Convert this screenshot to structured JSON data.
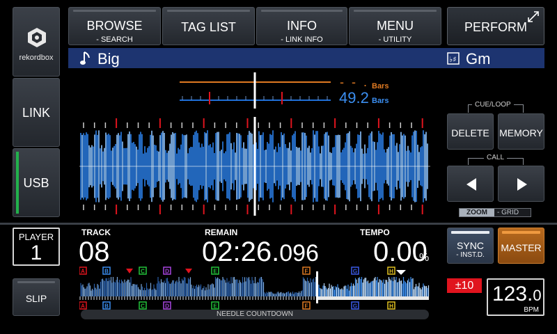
{
  "top_nav": {
    "browse": {
      "label": "BROWSE",
      "sub": "- SEARCH"
    },
    "tag_list": {
      "label": "TAG LIST"
    },
    "info": {
      "label": "INFO",
      "sub": "- LINK INFO"
    },
    "menu": {
      "label": "MENU",
      "sub": "- UTILITY"
    },
    "perform": {
      "label": "PERFORM"
    }
  },
  "left_panel": {
    "logo_text": "rekordbox",
    "link_label": "LINK",
    "usb_label": "USB"
  },
  "track": {
    "title": "Big",
    "key": "Gm"
  },
  "phase_meter": {
    "top_value": "- - .",
    "top_unit": "Bars",
    "bottom_value": "49.2",
    "bottom_unit": "Bars"
  },
  "cue_loop": {
    "section_label": "CUE/LOOP",
    "delete_label": "DELETE",
    "memory_label": "MEMORY",
    "call_label": "CALL",
    "zoom_label": "ZOOM",
    "grid_label": "- GRID"
  },
  "player": {
    "label": "PLAYER",
    "number": "1"
  },
  "slip_label": "SLIP",
  "readouts": {
    "track_label": "TRACK",
    "track_value": "08",
    "remain_label": "REMAIN",
    "remain_main": "02:26.",
    "remain_ms": "096",
    "tempo_label": "TEMPO",
    "tempo_value": "0.00",
    "tempo_unit": "%"
  },
  "sync": {
    "label": "SYNC",
    "sub": "- INST.D.",
    "master_label": "MASTER"
  },
  "tempo_range": "±10",
  "bpm": {
    "value_main": "123.",
    "value_decimal": "0",
    "unit": "BPM"
  },
  "hot_cues": [
    "A",
    "B",
    "C",
    "D",
    "E",
    "F",
    "G",
    "H"
  ],
  "needle_label": "NEEDLE COUNTDOWN",
  "colors": {
    "accent_blue": "#1e6fd9",
    "orange": "#e07a22",
    "red_marker": "#e0141e",
    "tempo_range_bg": "#e0141e",
    "usb_active": "#22b14c",
    "title_bar": "#1d3470"
  }
}
